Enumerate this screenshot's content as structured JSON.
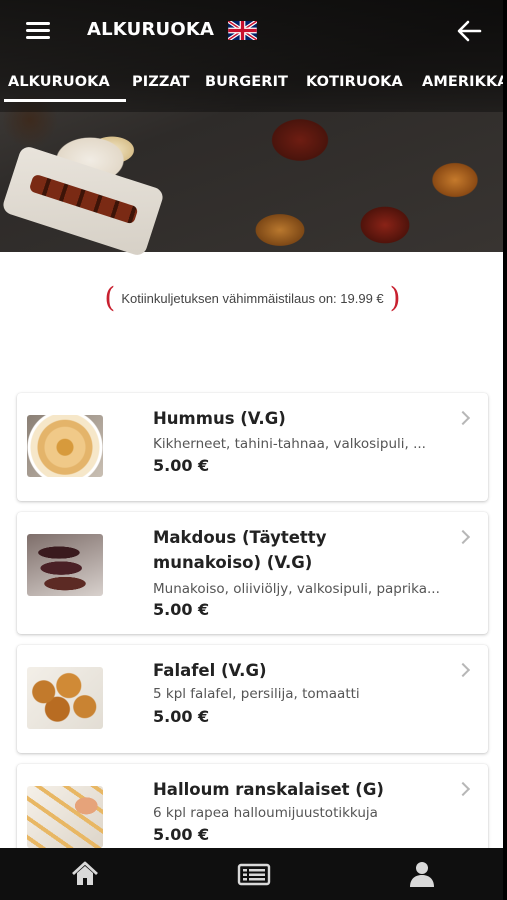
{
  "header": {
    "title": "ALKURUOKA",
    "menu_icon": "hamburger-menu-icon",
    "language_icon": "uk-flag-icon",
    "back_icon": "arrow-left-icon"
  },
  "tabs": [
    {
      "label": "ALKURUOKA",
      "active": true
    },
    {
      "label": "PIZZAT",
      "active": false
    },
    {
      "label": "BURGERIT",
      "active": false
    },
    {
      "label": "KOTIRUOKA",
      "active": false
    },
    {
      "label": "AMERIKKA",
      "active": false
    }
  ],
  "min_order": {
    "text": "Kotiinkuljetuksen vähimmäistilaus on: 19.99 €"
  },
  "products": [
    {
      "name": "Hummus (V.G)",
      "description": "Kikherneet, tahini-tahnaa, valkosipuli, ...",
      "price": "5.00 €"
    },
    {
      "name_line1": "Makdous (Täytetty",
      "name_line2": "munakoiso) (V.G)",
      "description": "Munakoiso, oliiviöljy, valkosipuli, paprika...",
      "price": "5.00 €"
    },
    {
      "name": "Falafel (V.G)",
      "description": "5 kpl falafel, persilija, tomaatti",
      "price": "5.00 €"
    },
    {
      "name": "Halloum ranskalaiset (G)",
      "description": "6 kpl rapea halloumijuustotikkuja",
      "price": "5.00 €"
    }
  ],
  "bottom_nav": {
    "items": [
      "home-icon",
      "menu-list-icon",
      "user-icon"
    ]
  },
  "colors": {
    "accent": "#c8202f",
    "nav_background": "#0f0f0f"
  }
}
